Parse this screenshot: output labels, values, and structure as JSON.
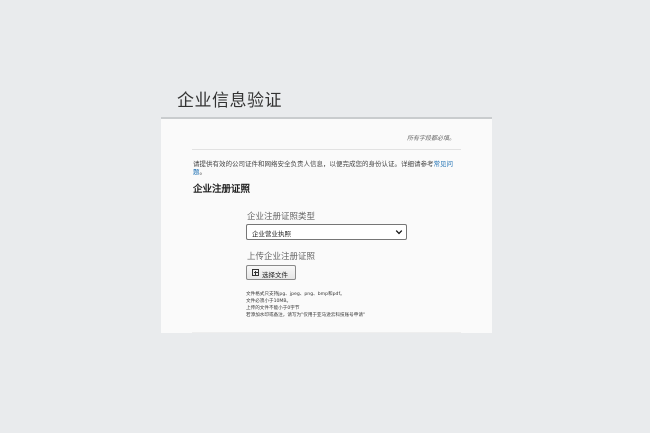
{
  "page": {
    "title": "企业信息验证"
  },
  "form": {
    "required_note": "所有字段都必填。",
    "intro_text": "请提供有效的公司证件和网络安全负责人信息，以便完成您的身份认证。详细请参考",
    "intro_link": "常见问题",
    "intro_end": "。",
    "section_title": "企业注册证照",
    "license_type_label": "企业注册证照类型",
    "license_type_selected": "企业营业执照",
    "upload_label": "上传企业注册证照",
    "choose_file_label": "选择文件",
    "notes": [
      "文件格式只支持jpg、jpeg、png、bmp和pdf。",
      "文件必须小于10MB。",
      "上传的文件不能小于0字节",
      "若添加水印或备注，请写为\"仅用于亚马逊云科技账号申请\""
    ]
  },
  "icons": {
    "select_arrow": "chevron-down-icon",
    "upload": "upload-icon"
  },
  "colors": {
    "background": "#e9ebed",
    "card": "#fafafa",
    "link": "#1b6fb3"
  }
}
